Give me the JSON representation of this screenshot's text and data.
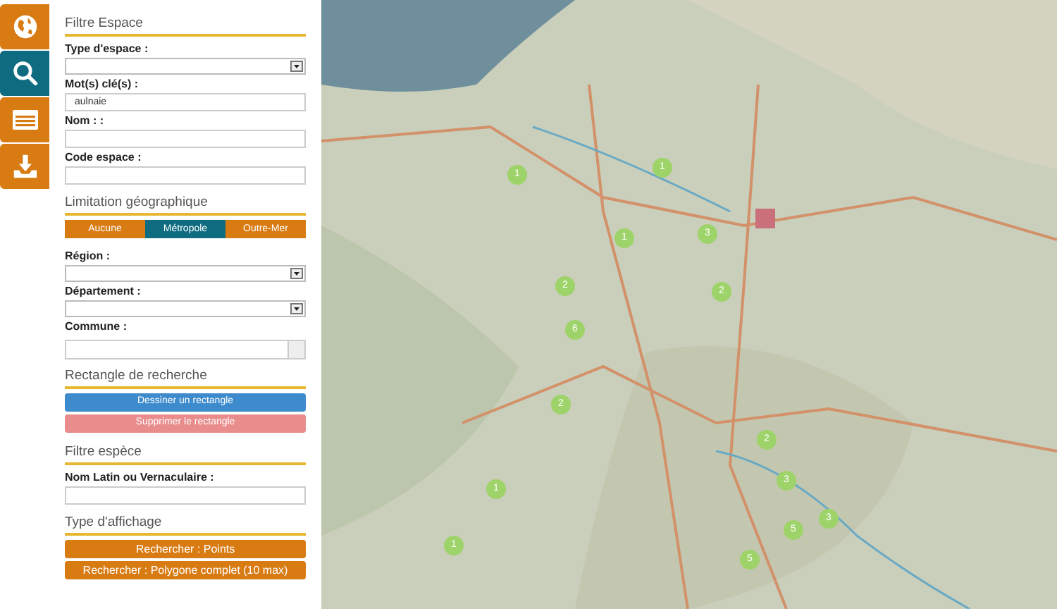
{
  "side_tabs": [
    {
      "kind": "globe",
      "selected": false
    },
    {
      "kind": "search",
      "selected": true
    },
    {
      "kind": "list",
      "selected": false
    },
    {
      "kind": "download",
      "selected": false
    }
  ],
  "sections": [
    {
      "title": "Filtre Espace",
      "items": [
        {
          "kind": "select",
          "label": "Type d'espace :"
        },
        {
          "kind": "input",
          "label": "Mot(s) clé(s) :",
          "value": "aulnaie"
        },
        {
          "kind": "input",
          "label": "Nom : :"
        },
        {
          "kind": "input",
          "label": "Code espace :"
        }
      ]
    },
    {
      "title": "Limitation géographique",
      "items": [
        {
          "kind": "segmented",
          "options": [
            {
              "label": "Aucune",
              "selected": false
            },
            {
              "label": "Métropole",
              "selected": true
            },
            {
              "label": "Outre-Mer",
              "selected": false
            }
          ]
        },
        {
          "kind": "select",
          "label": "Région :"
        },
        {
          "kind": "select",
          "label": "Département :"
        },
        {
          "kind": "combo",
          "label": "Commune :"
        }
      ]
    },
    {
      "title": "Rectangle de recherche",
      "items": [
        {
          "kind": "primary-button",
          "label": "Dessiner un rectangle"
        },
        {
          "kind": "danger-button",
          "label": "Supprimer le rectangle"
        }
      ]
    },
    {
      "title": "Filtre espèce",
      "items": [
        {
          "kind": "input",
          "label": "Nom Latin ou Vernaculaire :"
        }
      ]
    },
    {
      "title": "Type d'affichage",
      "items": [
        {
          "kind": "warning-button",
          "label": "Rechercher : Points"
        },
        {
          "kind": "warning-button",
          "label": "Rechercher : Polygone complet (10 max)"
        }
      ]
    }
  ],
  "map": {
    "clusters": [
      "1",
      "1",
      "1",
      "3",
      "2",
      "2",
      "6",
      "2",
      "2",
      "1",
      "3",
      "3",
      "5",
      "1",
      "5"
    ]
  }
}
